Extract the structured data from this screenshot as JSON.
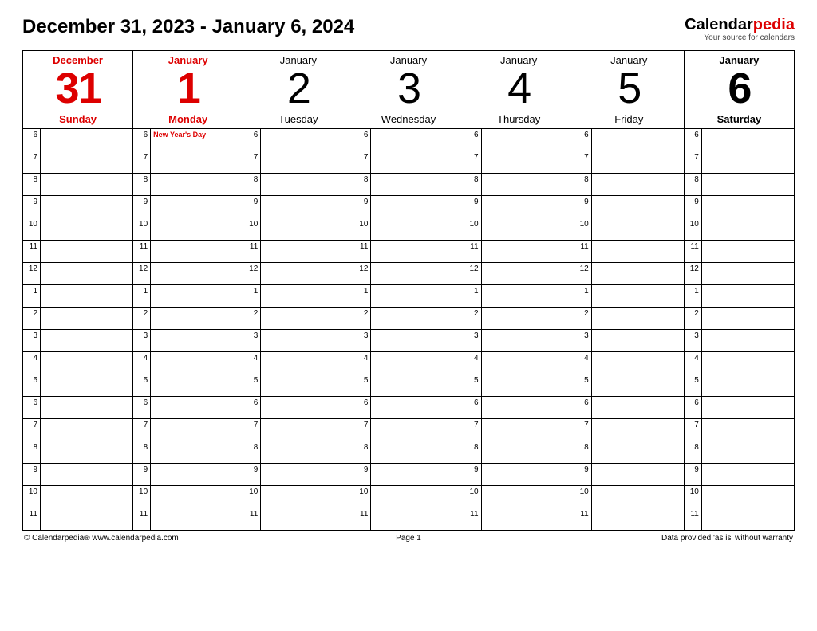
{
  "header": {
    "title": "December 31, 2023 - January 6, 2024",
    "brand_black": "Calendar",
    "brand_red": "pedia",
    "brand_tag": "Your source for calendars"
  },
  "days": [
    {
      "month": "December",
      "daynum": "31",
      "dow": "Sunday",
      "style": "red"
    },
    {
      "month": "January",
      "daynum": "1",
      "dow": "Monday",
      "style": "red"
    },
    {
      "month": "January",
      "daynum": "2",
      "dow": "Tuesday",
      "style": "normal"
    },
    {
      "month": "January",
      "daynum": "3",
      "dow": "Wednesday",
      "style": "normal"
    },
    {
      "month": "January",
      "daynum": "4",
      "dow": "Thursday",
      "style": "normal"
    },
    {
      "month": "January",
      "daynum": "5",
      "dow": "Friday",
      "style": "normal"
    },
    {
      "month": "January",
      "daynum": "6",
      "dow": "Saturday",
      "style": "boldblack"
    }
  ],
  "hours": [
    "6",
    "7",
    "8",
    "9",
    "10",
    "11",
    "12",
    "1",
    "2",
    "3",
    "4",
    "5",
    "6",
    "7",
    "8",
    "9",
    "10",
    "11"
  ],
  "events": {
    "1": {
      "0": "New Year's Day"
    }
  },
  "footer": {
    "left": "© Calendarpedia®   www.calendarpedia.com",
    "mid": "Page 1",
    "right": "Data provided 'as is' without warranty"
  }
}
